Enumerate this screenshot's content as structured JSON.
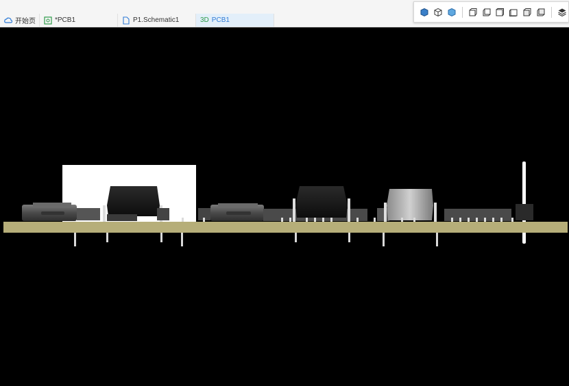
{
  "tabs": [
    {
      "label": "开始页",
      "icon": "cloud-icon"
    },
    {
      "label": "*PCB1",
      "icon": "pcb-icon"
    },
    {
      "label": "P1.Schematic1",
      "icon": "document-icon"
    },
    {
      "label": "PCB1",
      "icon": "3d-icon",
      "prefix": "3D",
      "active": true
    }
  ],
  "toolbar": {
    "buttons": [
      "view-iso-icon",
      "view-iso-wire-icon",
      "view-iso-shaded-icon",
      "view-front-icon",
      "view-back-icon",
      "view-left-icon",
      "view-right-icon",
      "view-top-icon",
      "view-bottom-icon",
      "layers-icon"
    ]
  },
  "colors": {
    "board": "#b6ae79",
    "background": "#000000",
    "accent": "#2f7bd6"
  }
}
